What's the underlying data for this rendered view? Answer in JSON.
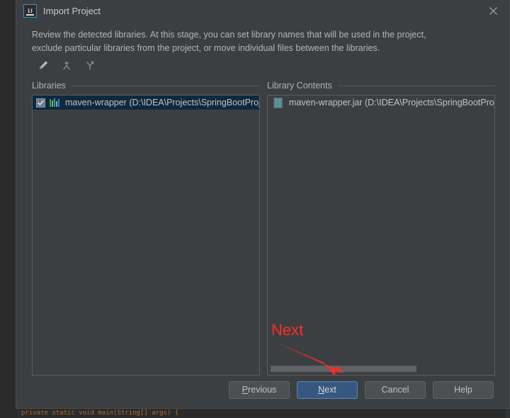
{
  "window": {
    "title": "Import Project",
    "logo_icon": "intellij-idea-logo",
    "close_icon": "close-icon"
  },
  "description": {
    "line1": "Review the detected libraries. At this stage, you can set library names that will be used in the project,",
    "line2": "exclude particular libraries from the project, or move individual files between the libraries."
  },
  "toolbar": {
    "items": [
      {
        "name": "rename-library-button",
        "icon": "pencil-icon",
        "tooltip": "Rename"
      },
      {
        "name": "merge-libraries-button",
        "icon": "merge-icon",
        "tooltip": "Merge"
      },
      {
        "name": "split-library-button",
        "icon": "split-icon",
        "tooltip": "Split"
      }
    ]
  },
  "libraries_pane": {
    "title": "Libraries",
    "rows": [
      {
        "label": "maven-wrapper (D:\\IDEA\\Projects\\SpringBootProj",
        "checked": true,
        "selected": true,
        "icon": "library-icon"
      }
    ]
  },
  "library_contents_pane": {
    "title": "Library Contents",
    "rows": [
      {
        "label": "maven-wrapper.jar (D:\\IDEA\\Projects\\SpringBootProj",
        "icon": "jar-file-icon"
      }
    ],
    "scrollbar": {
      "name": "horizontal-scrollbar",
      "thumb_percent": 66
    }
  },
  "annotation": {
    "text": "Next",
    "color": "#ff2b2b",
    "arrow_icon": "red-arrow-icon"
  },
  "footer": {
    "buttons": [
      {
        "name": "previous-button",
        "label": "Previous",
        "mnemonic": "P",
        "primary": false
      },
      {
        "name": "next-button",
        "label": "Next",
        "mnemonic": "N",
        "primary": true
      },
      {
        "name": "cancel-button",
        "label": "Cancel",
        "mnemonic": "",
        "primary": false
      },
      {
        "name": "help-button",
        "label": "Help",
        "mnemonic": "",
        "primary": false
      }
    ]
  },
  "background": {
    "code_snippet": "private static void main(String[] args) {"
  },
  "colors": {
    "dialog_bg": "#3c3f41",
    "selection_bg": "#0d293f",
    "primary_button": "#365880",
    "accent": "#3592c4",
    "annotation_red": "#ff2b2b"
  }
}
